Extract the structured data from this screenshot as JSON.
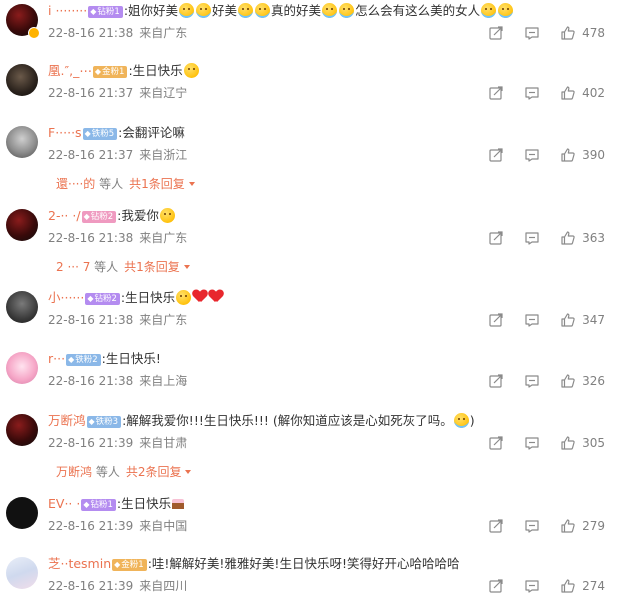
{
  "comments": [
    {
      "name": "i ········",
      "medal": "钻粉1",
      "medal_color": "purple",
      "text": "姐你好美😭😭好美😭😭真的好美😭😭怎么会有这么美的女人😭😭",
      "parts": [
        ":姐你好美",
        "好美",
        "真的好美",
        "怎么会有这么美的女人"
      ],
      "time": "22-8-16 21:38",
      "location": "来自广东",
      "likes": "478",
      "avatar": "a-red",
      "badge": true
    },
    {
      "name": "凰.″,_⋯",
      "medal": "金粉1",
      "medal_color": "orange",
      "text": ":生日快乐",
      "time": "22-8-16 21:37",
      "location": "来自辽宁",
      "likes": "402",
      "avatar": "a-dark"
    },
    {
      "name": "F·····s",
      "medal": "铁粉5",
      "medal_color": "blue",
      "text": ":会翻评论嘛",
      "time": "22-8-16 21:37",
      "location": "来自浙江",
      "likes": "390",
      "avatar": "a-gray",
      "reply": {
        "name": "還····的",
        "suffix": "等人",
        "link": "共1条回复"
      }
    },
    {
      "name": "2-·· ·/",
      "medal": "钻粉2",
      "medal_color": "pink",
      "text": ":我爱你",
      "time": "22-8-16 21:38",
      "location": "来自广东",
      "likes": "363",
      "avatar": "a-red",
      "reply": {
        "name": "2 ··· 7",
        "suffix": "等人",
        "link": "共1条回复"
      }
    },
    {
      "name": "小······",
      "medal": "钻粉2",
      "medal_color": "purple",
      "text": ":生日快乐",
      "time": "22-8-16 21:38",
      "location": "来自广东",
      "likes": "347",
      "avatar": "a-mono"
    },
    {
      "name": "r···",
      "medal": "铁粉2",
      "medal_color": "blue",
      "text": ":生日快乐!",
      "time": "22-8-16 21:38",
      "location": "来自上海",
      "likes": "326",
      "avatar": "a-pink"
    },
    {
      "name": "万断鸿",
      "medal": "铁粉3",
      "medal_color": "blue",
      "text": ":解解我爱你!!!生日快乐!!! (解你知道应该是心如死灰了吗。",
      "time": "22-8-16 21:39",
      "location": "来自甘肃",
      "likes": "305",
      "avatar": "a-red",
      "reply": {
        "name": "万断鸿",
        "suffix": "等人",
        "link": "共2条回复"
      }
    },
    {
      "name": "EV·· ·",
      "medal": "钻粉1",
      "medal_color": "purple",
      "text": ":生日快乐",
      "time": "22-8-16 21:39",
      "location": "来自中国",
      "likes": "279",
      "avatar": "a-black"
    },
    {
      "name": "芝··tesmin",
      "medal": "金粉1",
      "medal_color": "orange",
      "text": ":哇!解解好美!雅雅好美!生日快乐呀!笑得好开心哈哈哈哈",
      "time": "22-8-16 21:39",
      "location": "来自四川",
      "likes": "274",
      "avatar": "a-sky"
    }
  ],
  "icons": {
    "share": "share-icon",
    "comment": "comment-icon",
    "like": "like-icon"
  }
}
